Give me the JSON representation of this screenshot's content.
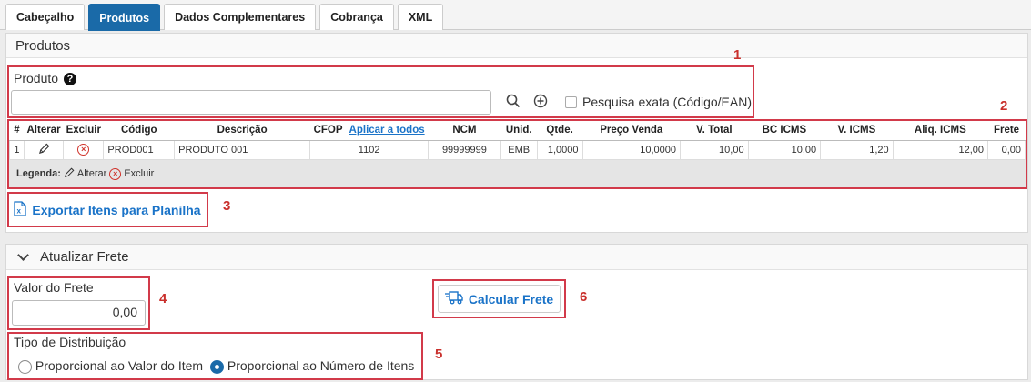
{
  "tabs": [
    {
      "label": "Cabeçalho",
      "active": false
    },
    {
      "label": "Produtos",
      "active": true
    },
    {
      "label": "Dados Complementares",
      "active": false
    },
    {
      "label": "Cobrança",
      "active": false
    },
    {
      "label": "XML",
      "active": false
    }
  ],
  "produtos_panel": {
    "title": "Produtos",
    "produto_label": "Produto",
    "produto_value": "",
    "pesquisa_exata_label": "Pesquisa exata (Código/EAN)",
    "pesquisa_exata_checked": false
  },
  "table": {
    "columns": [
      "#",
      "Alterar",
      "Excluir",
      "Código",
      "Descrição",
      "CFOP",
      "Aplicar a todos",
      "NCM",
      "Unid.",
      "Qtde.",
      "Preço Venda",
      "V. Total",
      "BC ICMS",
      "V. ICMS",
      "Aliq. ICMS",
      "Frete"
    ],
    "rows": [
      {
        "num": "1",
        "codigo": "PROD001",
        "descricao": "PRODUTO 001",
        "cfop": "1102",
        "ncm": "99999999",
        "unid": "EMB",
        "qtde": "1,0000",
        "preco": "10,0000",
        "vtotal": "10,00",
        "bc_icms": "10,00",
        "v_icms": "1,20",
        "aliq_icms": "12,00",
        "frete": "0,00"
      }
    ],
    "legend": {
      "prefix": "Legenda:",
      "alterar": "Alterar",
      "excluir": "Excluir"
    }
  },
  "export_button": "Exportar Itens para Planilha",
  "frete_panel": {
    "title": "Atualizar Frete",
    "valor_label": "Valor do Frete",
    "valor_value": "0,00",
    "calcular_button": "Calcular Frete",
    "tipo_label": "Tipo de Distribuição",
    "options": [
      {
        "label": "Proporcional ao Valor do Item",
        "selected": false
      },
      {
        "label": "Proporcional ao Número de Itens",
        "selected": true
      }
    ]
  },
  "markers": [
    "1",
    "2",
    "3",
    "4",
    "5",
    "6"
  ],
  "colors": {
    "accent": "#1a6aa8",
    "link": "#1a73c8",
    "highlight": "#d23a4a",
    "danger": "#d0342c"
  }
}
